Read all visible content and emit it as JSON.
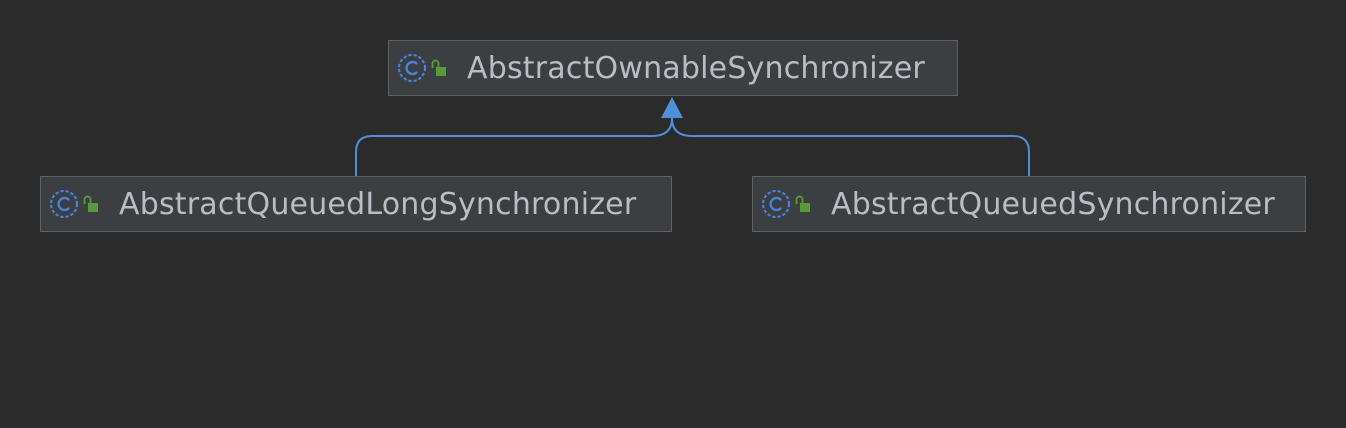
{
  "diagram": {
    "nodes": [
      {
        "id": "abstract-ownable-synchronizer",
        "name": "AbstractOwnableSynchronizer",
        "kind_icon": "class-icon",
        "visibility_icon": "public-lock-icon"
      },
      {
        "id": "abstract-queued-long-synchronizer",
        "name": "AbstractQueuedLongSynchronizer",
        "kind_icon": "class-icon",
        "visibility_icon": "public-lock-icon"
      },
      {
        "id": "abstract-queued-synchronizer",
        "name": "AbstractQueuedSynchronizer",
        "kind_icon": "class-icon",
        "visibility_icon": "public-lock-icon"
      }
    ],
    "edges": [
      {
        "from": "abstract-queued-long-synchronizer",
        "to": "abstract-ownable-synchronizer",
        "type": "extends"
      },
      {
        "from": "abstract-queued-synchronizer",
        "to": "abstract-ownable-synchronizer",
        "type": "extends"
      }
    ],
    "colors": {
      "background": "#2b2b2b",
      "node_fill": "#3c3f41",
      "node_border": "#5e6164",
      "text": "#b9bec6",
      "edge": "#4e8fd8",
      "class_icon": "#4a86e8",
      "lock_icon": "#5b9a3c"
    }
  }
}
